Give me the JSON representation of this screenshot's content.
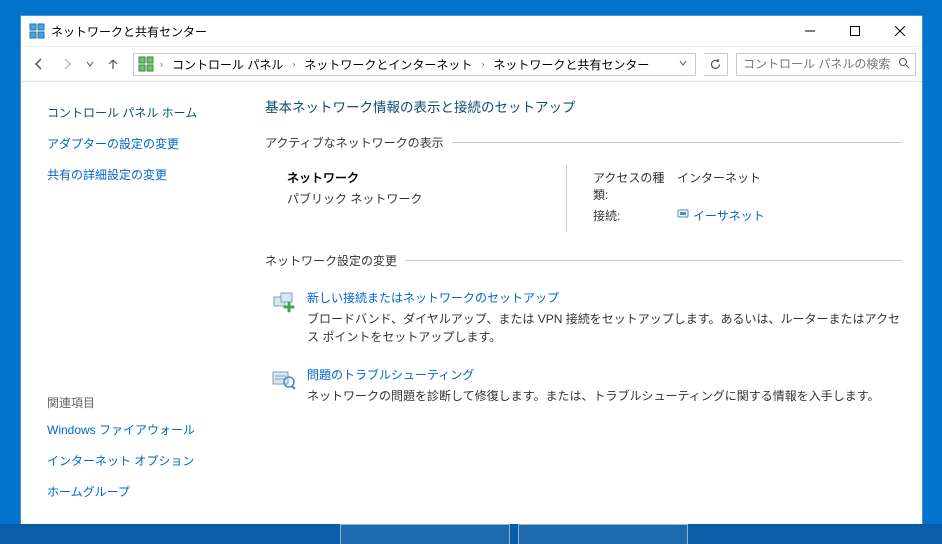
{
  "title": "ネットワークと共有センター",
  "breadcrumb": {
    "items": [
      "コントロール パネル",
      "ネットワークとインターネット",
      "ネットワークと共有センター"
    ]
  },
  "search": {
    "placeholder": "コントロール パネルの検索"
  },
  "sidebar": {
    "home": "コントロール パネル ホーム",
    "links": [
      "アダプターの設定の変更",
      "共有の詳細設定の変更"
    ],
    "related_title": "関連項目",
    "related": [
      "Windows ファイアウォール",
      "インターネット オプション",
      "ホームグループ"
    ]
  },
  "main": {
    "title": "基本ネットワーク情報の表示と接続のセットアップ",
    "active_label": "アクティブなネットワークの表示",
    "network": {
      "name": "ネットワーク",
      "type": "パブリック ネットワーク",
      "access_label": "アクセスの種類:",
      "access_value": "インターネット",
      "conn_label": "接続:",
      "conn_value": "イーサネット"
    },
    "change_label": "ネットワーク設定の変更",
    "items": [
      {
        "link": "新しい接続またはネットワークのセットアップ",
        "desc": "ブロードバンド、ダイヤルアップ、または VPN 接続をセットアップします。あるいは、ルーターまたはアクセス ポイントをセットアップします。"
      },
      {
        "link": "問題のトラブルシューティング",
        "desc": "ネットワークの問題を診断して修復します。または、トラブルシューティングに関する情報を入手します。"
      }
    ]
  }
}
